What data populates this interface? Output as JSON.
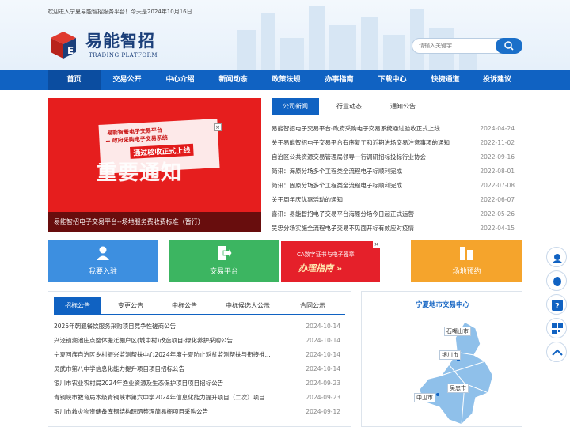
{
  "header": {
    "welcome": "欢迎进入宁夏易能智招服务平台！今天是2024年10月16日",
    "logo_cn": "易能智招",
    "logo_en": "TRADING PLATFORM",
    "search_placeholder": "请输入关键字"
  },
  "nav": [
    "首页",
    "交易公开",
    "中心介绍",
    "新闻动态",
    "政策法规",
    "办事指南",
    "下载中心",
    "快捷通道",
    "投诉建议"
  ],
  "banner": {
    "line1": "易能智餐电子交易平台",
    "line2": "-- 政府采购电子交易系统",
    "line3": "通过验收正式上线",
    "big": "重要通知",
    "close": "×",
    "caption": "易能智招电子交易平台--场地服务费收费标准（暂行）"
  },
  "news_tabs": [
    "公司新闻",
    "行业动态",
    "通知公告"
  ],
  "news": [
    {
      "title": "易能智招电子交易平台-政府采购电子交易系统通过验收正式上线",
      "date": "2024-04-24"
    },
    {
      "title": "关于易能智招电子交易平台有序复工和近期进场交易注意事项的通知",
      "date": "2022-11-02"
    },
    {
      "title": "自治区公共资源交易管理局领导一行调研招标投标行业协会",
      "date": "2022-09-16"
    },
    {
      "title": "简讯：海原分场多个工程类全流程电子标顺利完成",
      "date": "2022-08-01"
    },
    {
      "title": "简讯：固原分场多个工程类全流程电子标顺利完成",
      "date": "2022-07-08"
    },
    {
      "title": "关于周年庆优惠活动的通知",
      "date": "2022-06-07"
    },
    {
      "title": "喜讯：易能智招电子交易平台海原分场今日起正式运营",
      "date": "2022-05-26"
    },
    {
      "title": "吴忠分场实施全流程电子交易不见面开标有效应对疫情",
      "date": "2022-04-15"
    }
  ],
  "tiles": {
    "join": "我要入驻",
    "platform": "交易平台",
    "venue": "场地预约",
    "ca_line1": "CA数字证书与电子签章",
    "ca_line2": "办理指南 »",
    "ca_close": "×"
  },
  "announce_tabs": [
    "招标公告",
    "变更公告",
    "中标公告",
    "中标候选人公示",
    "合同公示"
  ],
  "announcements": [
    {
      "title": "2025年朝觐餐饮服务采购项目竞争性磋商公告",
      "date": "2024-10-14"
    },
    {
      "title": "兴泾镇溯池庄点整体搬迁棚户区(城中村)改造项目-绿化养护采购公告",
      "date": "2024-10-14"
    },
    {
      "title": "宁夏回族自治区乡村振兴监测帮扶中心2024年度宁夏防止返贫监测帮扶与衔接推...",
      "date": "2024-10-14"
    },
    {
      "title": "灵武市第八中学信息化能力提升项目项目招标公告",
      "date": "2024-10-14"
    },
    {
      "title": "银川市农业农村局2024年渔业资源及生态保护项目项目招标公告",
      "date": "2024-09-23"
    },
    {
      "title": "青铜峡市教育局本级青铜峡市第六中学2024年信息化能力提升项目（二次）项目...",
      "date": "2024-09-23"
    },
    {
      "title": "银川市救灾物资储备库钢结构晾晒整理简易棚项目采购公告",
      "date": "2024-09-12"
    }
  ],
  "map": {
    "title": "宁夏地市交易中心",
    "cities": [
      "石嘴山市",
      "银川市",
      "吴忠市",
      "中卫市"
    ]
  },
  "colors": {
    "primary": "#1062c2",
    "red": "#e61e1e",
    "tile_blue": "#3d8fe0",
    "tile_green": "#3cb561",
    "tile_orange": "#f5a42c"
  }
}
